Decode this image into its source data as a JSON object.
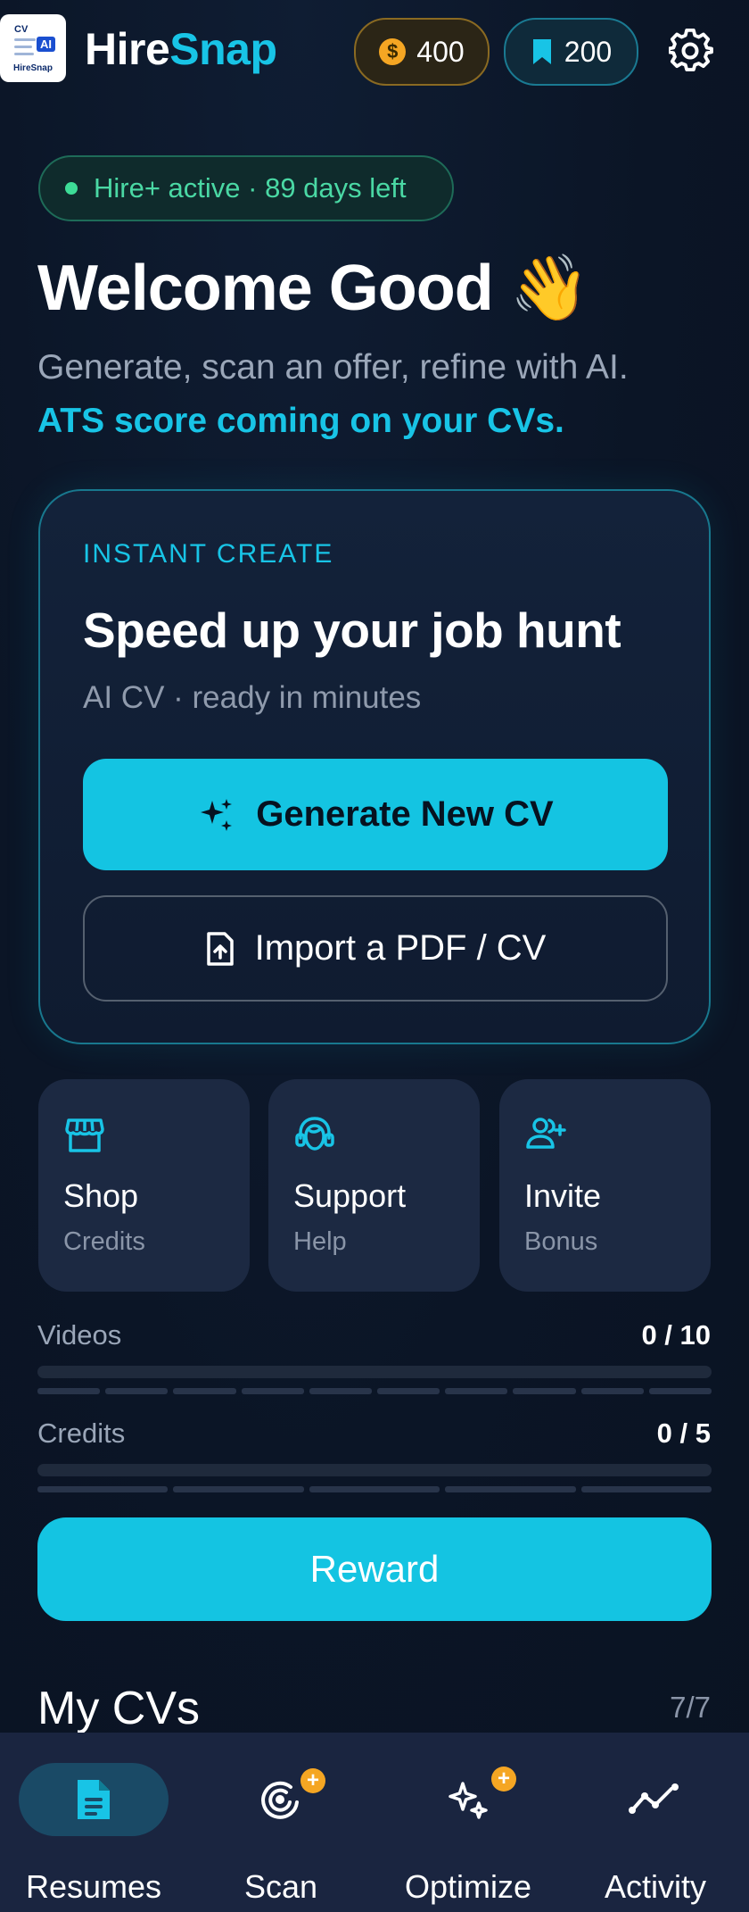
{
  "header": {
    "logo_text_top": "CV",
    "logo_text_ai": "AI",
    "logo_text_name": "HireSnap",
    "brand_part1": "Hire",
    "brand_part2": "Snap",
    "coins": "400",
    "saves": "200",
    "coin_symbol": "$",
    "icons": {
      "coins": "coin-icon",
      "saves": "bookmark-icon",
      "settings": "gear-icon"
    }
  },
  "status": {
    "text": "Hire+ active · 89 days left"
  },
  "welcome": {
    "title": "Welcome Good",
    "emoji": "👋"
  },
  "subtitle": {
    "line1": "Generate, scan an offer, refine with AI.",
    "line2": "ATS score coming on your CVs."
  },
  "card": {
    "kicker": "INSTANT CREATE",
    "headline": "Speed up your job hunt",
    "meta": "AI CV · ready in minutes",
    "primary_label": "Generate New CV",
    "secondary_label": "Import a PDF / CV"
  },
  "tiles": [
    {
      "title": "Shop",
      "subtitle": "Credits",
      "icon": "store-icon"
    },
    {
      "title": "Support",
      "subtitle": "Help",
      "icon": "headset-icon"
    },
    {
      "title": "Invite",
      "subtitle": "Bonus",
      "icon": "add-user-icon"
    }
  ],
  "progress": {
    "videos": {
      "label": "Videos",
      "value": "0 / 10",
      "current": 0,
      "max": 10
    },
    "credits": {
      "label": "Credits",
      "value": "0 / 5",
      "current": 0,
      "max": 5
    }
  },
  "reward": {
    "label": "Reward"
  },
  "section": {
    "title": "My CVs",
    "count": "7/7"
  },
  "nav": [
    {
      "label": "Resumes",
      "icon": "document-icon",
      "active": true
    },
    {
      "label": "Scan",
      "icon": "scan-icon",
      "badge": "+"
    },
    {
      "label": "Optimize",
      "icon": "sparkles-icon",
      "badge": "+"
    },
    {
      "label": "Activity",
      "icon": "activity-icon"
    }
  ],
  "colors": {
    "accent": "#18c4e6",
    "background": "#0b1526",
    "success": "#3ddc97",
    "badge": "#f5a623"
  }
}
